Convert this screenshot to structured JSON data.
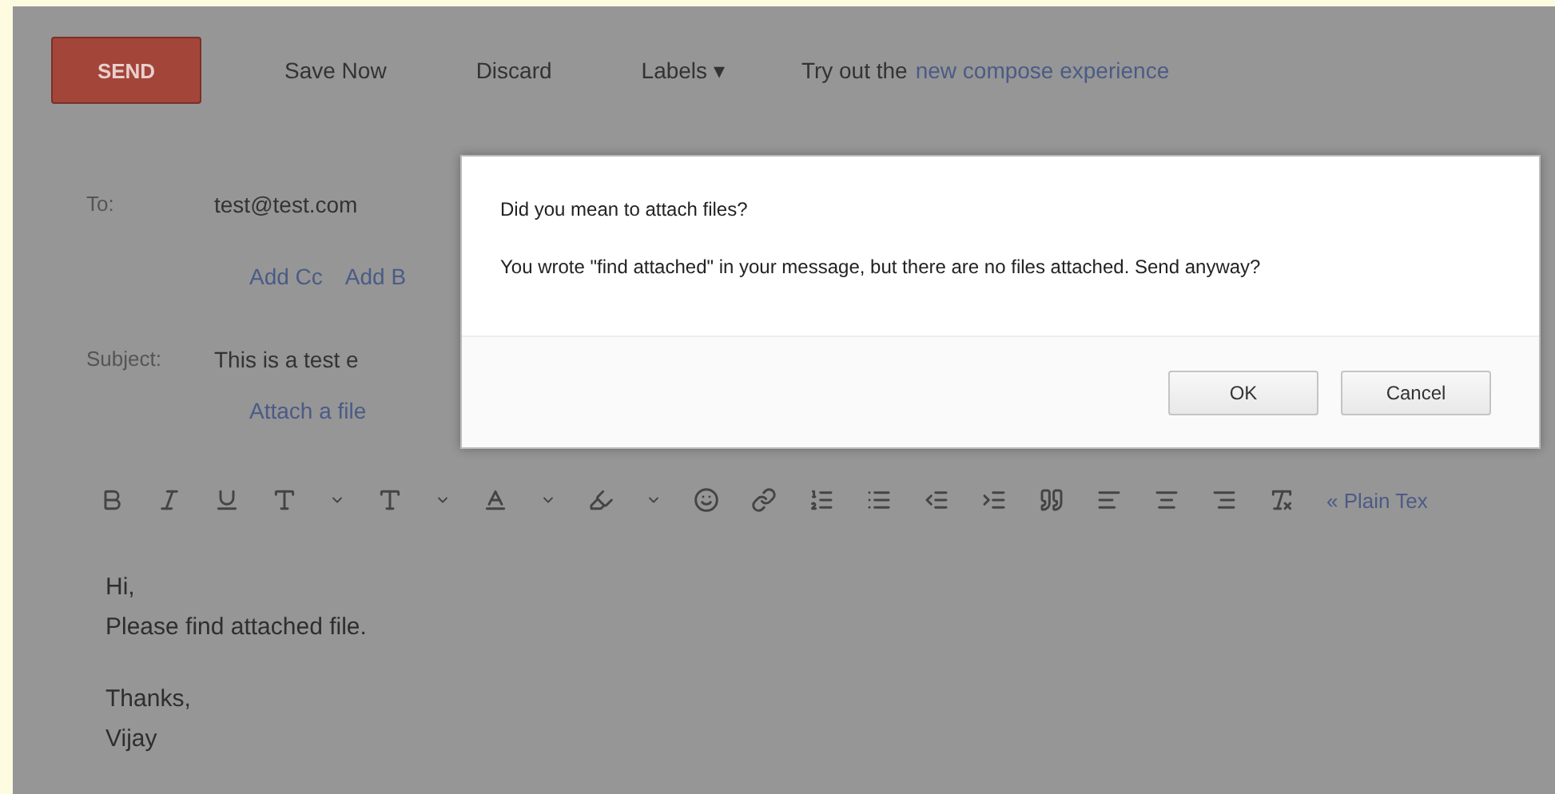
{
  "toolbar": {
    "send": "SEND",
    "buttons": [
      "Save Now",
      "Discard"
    ],
    "labels_menu": "Labels ▾",
    "promo_text": "Try out the",
    "promo_link": "new compose experience"
  },
  "fields": {
    "to_label": "To:",
    "to_value": "test@test.com",
    "add_links": [
      "Add Cc",
      "Add B"
    ],
    "subject_label": "Subject:",
    "subject_value": "This is a test e",
    "attach_link": "Attach a file"
  },
  "format_bar": {
    "plain_text_link": "« Plain Tex"
  },
  "body": [
    {
      "lines": [
        "Hi,",
        "Please find attached file."
      ]
    },
    {
      "lines": [
        "Thanks,",
        "Vijay"
      ]
    }
  ],
  "dialog": {
    "title": "Did you mean to attach files?",
    "message": "You wrote \"find attached\" in your message, but there are no files attached. Send anyway?",
    "buttons": [
      "OK",
      "Cancel"
    ]
  }
}
